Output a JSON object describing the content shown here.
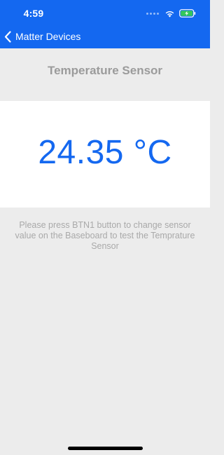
{
  "status_bar": {
    "time": "4:59",
    "icons": [
      "cellular-dots-icon",
      "wifi-icon",
      "battery-charging-icon"
    ]
  },
  "nav": {
    "back_label": "Matter Devices"
  },
  "page": {
    "title": "Temperature Sensor",
    "reading": "24.35 °C",
    "instructions": "Please press BTN1 button to change sensor value on the Baseboard to test the Temprature Sensor"
  },
  "colors": {
    "accent": "#1468f0",
    "background": "#ececec",
    "card": "#ffffff",
    "muted_text": "#a9a9a9",
    "battery_fill": "#34c759"
  }
}
